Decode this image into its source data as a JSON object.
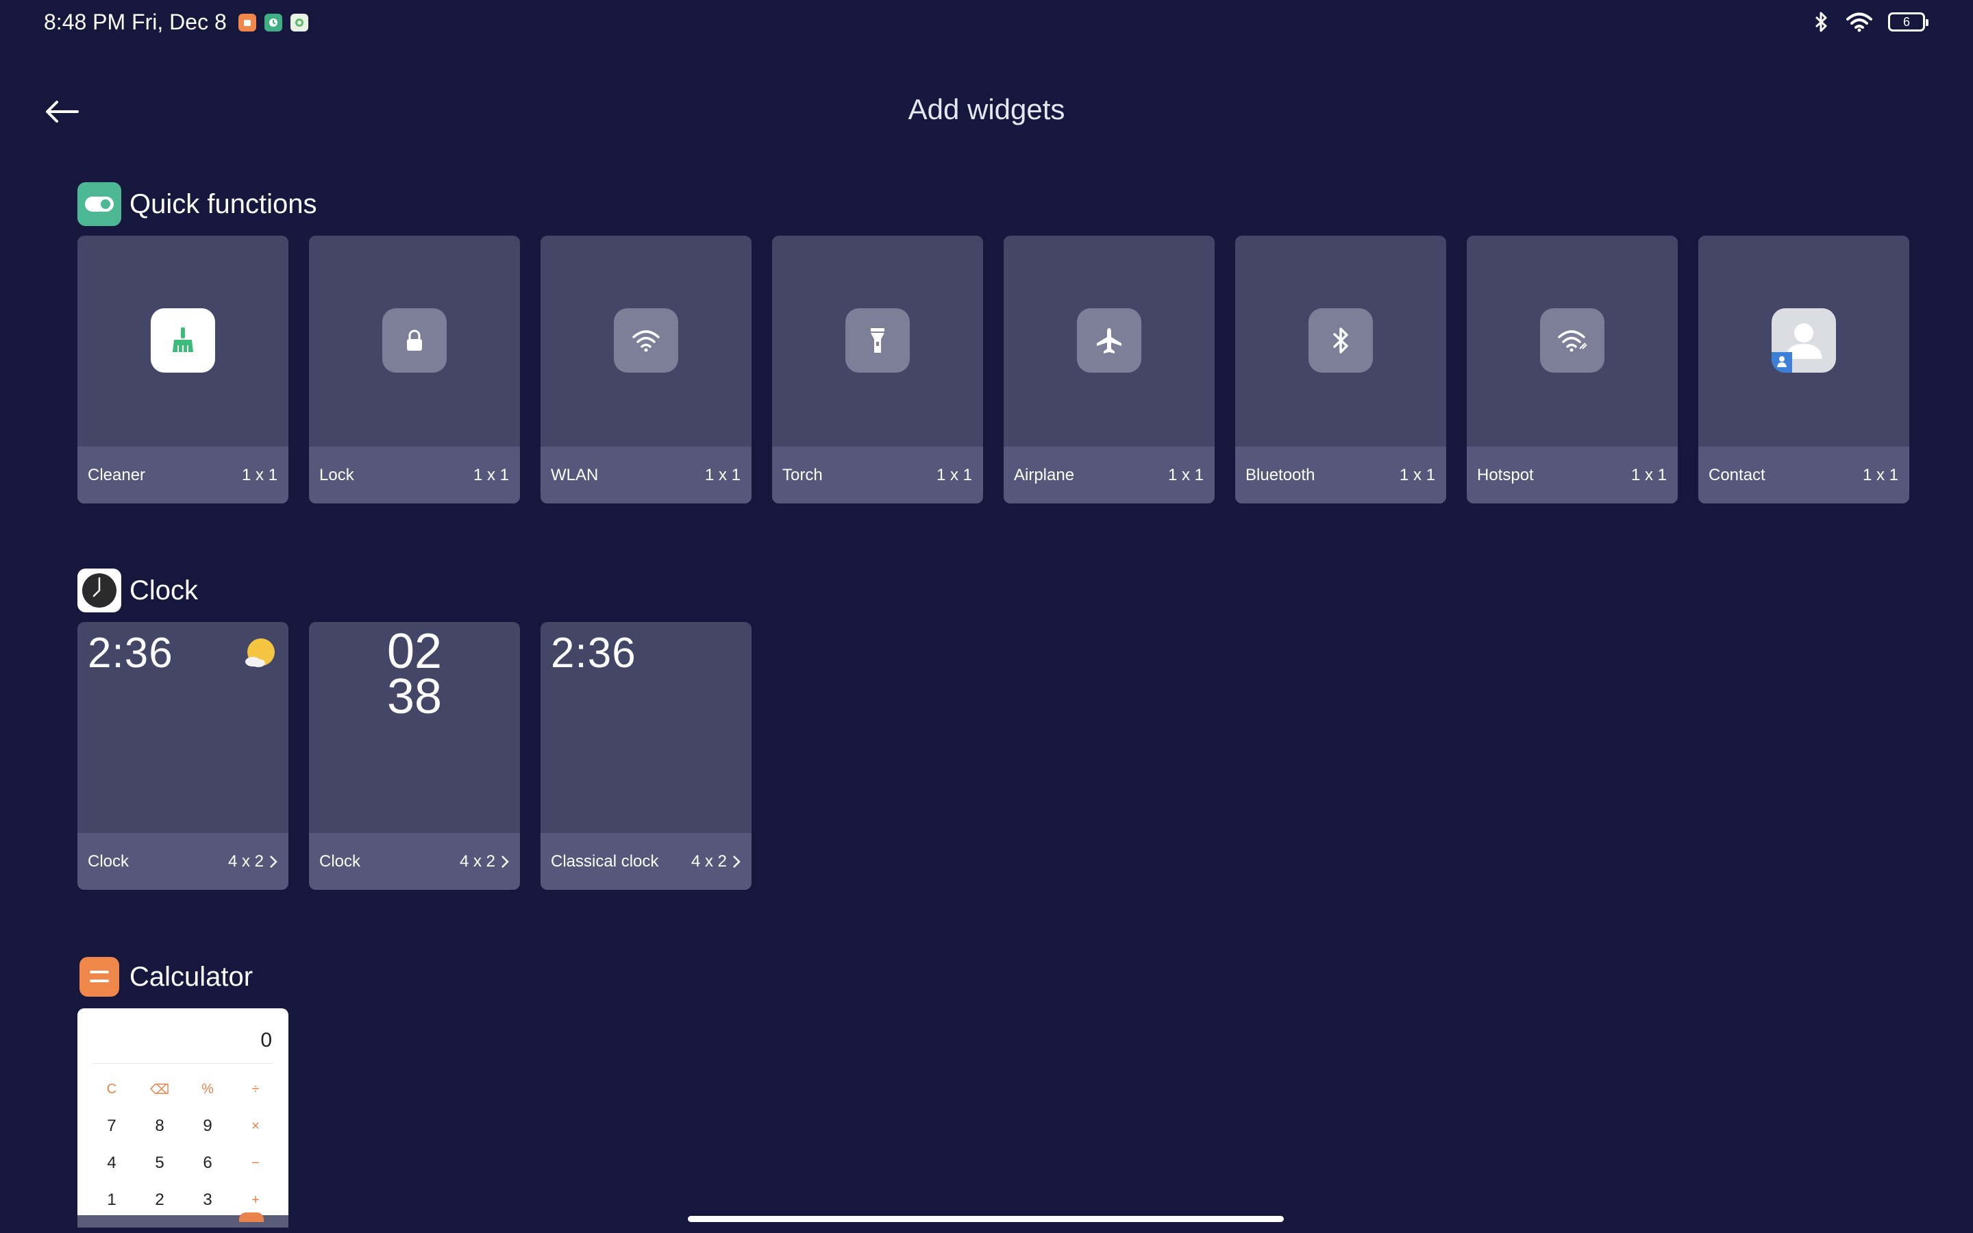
{
  "status_bar": {
    "time": "8:48 PM Fri, Dec 8",
    "battery": "6",
    "notification_icons": [
      "app-notification-icon",
      "clock-notification-icon",
      "app-notification-icon"
    ],
    "right_icons": [
      "bluetooth-icon",
      "wifi-icon",
      "battery-icon"
    ]
  },
  "header": {
    "title": "Add widgets",
    "back_icon": "back-arrow-icon"
  },
  "sections": {
    "quick_functions": {
      "title": "Quick functions",
      "icon": "toggle-icon",
      "icon_color": "#4db894",
      "items": [
        {
          "label": "Cleaner",
          "size": "1 x 1",
          "icon": "broom-icon"
        },
        {
          "label": "Lock",
          "size": "1 x 1",
          "icon": "lock-icon"
        },
        {
          "label": "WLAN",
          "size": "1 x 1",
          "icon": "wifi-icon"
        },
        {
          "label": "Torch",
          "size": "1 x 1",
          "icon": "flashlight-icon"
        },
        {
          "label": "Airplane",
          "size": "1 x 1",
          "icon": "airplane-icon"
        },
        {
          "label": "Bluetooth",
          "size": "1 x 1",
          "icon": "bluetooth-icon"
        },
        {
          "label": "Hotspot",
          "size": "1 x 1",
          "icon": "hotspot-icon"
        },
        {
          "label": "Contact",
          "size": "1 x 1",
          "icon": "contact-icon"
        }
      ]
    },
    "clock": {
      "title": "Clock",
      "icon": "clock-icon",
      "items": [
        {
          "label": "Clock",
          "size": "4 x 2",
          "preview_time": "2:36",
          "icon": "weather-icon"
        },
        {
          "label": "Clock",
          "size": "4 x 2",
          "preview_hour": "02",
          "preview_minute": "38"
        },
        {
          "label": "Classical clock",
          "size": "4 x 2",
          "preview_time": "2:36"
        }
      ]
    },
    "calculator": {
      "title": "Calculator",
      "icon": "calculator-icon",
      "icon_color": "#f0874a",
      "display": "0",
      "keys": [
        "C",
        "⌫",
        "%",
        "÷",
        "7",
        "8",
        "9",
        "×",
        "4",
        "5",
        "6",
        "−",
        "1",
        "2",
        "3",
        "+"
      ]
    }
  },
  "colors": {
    "background": "#15173d",
    "card": "#434666",
    "card_footer": "#55587a",
    "accent_orange": "#e8834c",
    "cleaner_green": "#3dbb7c"
  }
}
